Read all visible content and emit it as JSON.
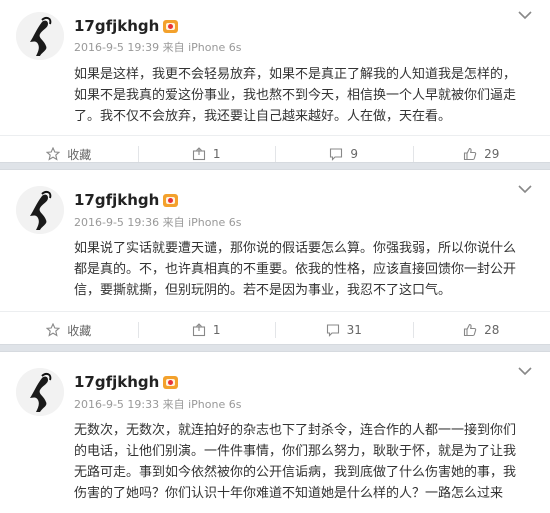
{
  "posts": [
    {
      "username": "17gfjkhgh",
      "meta": "2016-9-5 19:39 来自 iPhone 6s",
      "text": "如果是这样，我更不会轻易放弃，如果不是真正了解我的人知道我是怎样的，如果不是我真的爱这份事业，我也熬不到今天，相信换一个人早就被你们逼走了。我不仅不会放弃，我还要让自己越来越好。人在做，天在看。",
      "actions": {
        "favorite": "收藏",
        "share": "1",
        "comment": "9",
        "like": "29"
      }
    },
    {
      "username": "17gfjkhgh",
      "meta": "2016-9-5 19:36 来自 iPhone 6s",
      "text": "如果说了实话就要遭天谴，那你说的假话要怎么算。你强我弱，所以你说什么都是真的。不，也许真相真的不重要。依我的性格，应该直接回馈你一封公开信，要撕就撕，但别玩阴的。若不是因为事业，我忍不了这口气。",
      "actions": {
        "favorite": "收藏",
        "share": "1",
        "comment": "31",
        "like": "28"
      }
    },
    {
      "username": "17gfjkhgh",
      "meta": "2016-9-5 19:33 来自 iPhone 6s",
      "text": "无数次，无数次，就连拍好的杂志也下了封杀令，连合作的人都一一接到你们的电话，让他们别演。一件件事情，你们那么努力，耿耿于怀，就是为了让我无路可走。事到如今依然被你的公开信诟病，我到底做了什么伤害她的事，我伤害的了她吗？你们认识十年你难道不知道她是什么样的人？一路怎么过来的？",
      "actions": {
        "favorite": "收藏",
        "share": "",
        "comment": "",
        "like": ""
      }
    }
  ],
  "colors": {
    "separator": "#dfe3e8",
    "vip_badge": "#f3a12c",
    "meta_text": "#999999"
  },
  "icons": [
    "chevron-down-icon",
    "star-icon",
    "share-icon",
    "comment-icon",
    "like-icon"
  ]
}
